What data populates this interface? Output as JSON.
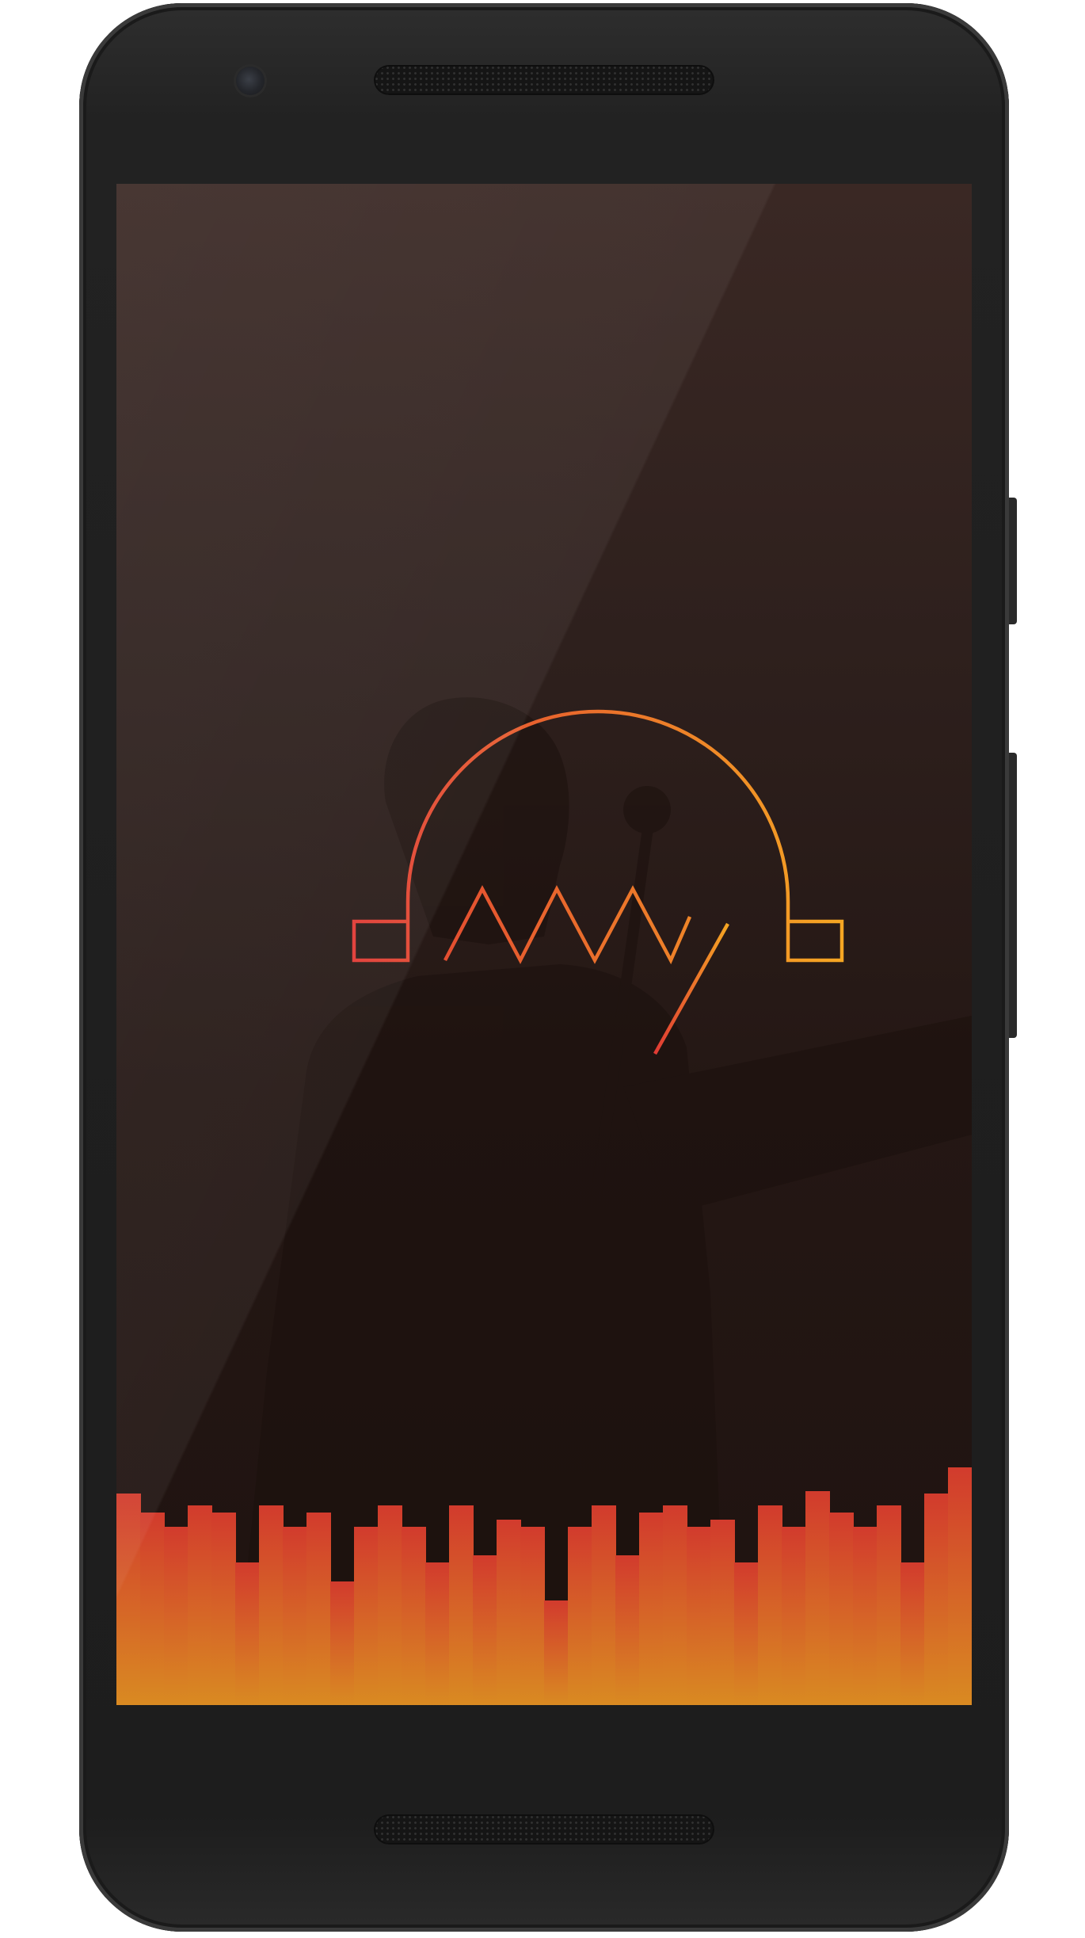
{
  "colors": {
    "background_top": "#3a2824",
    "background_bottom": "#1f1310",
    "logo_gradient_start": "#e03a34",
    "logo_gradient_end": "#f5a623",
    "bar_top": "#d23b2d",
    "bar_bottom": "#d98a22"
  },
  "logo": {
    "name": "headphones-waveform-logo",
    "wordmark_glyphs": "AAAy"
  },
  "equalizer": {
    "levels": [
      0.89,
      0.81,
      0.75,
      0.84,
      0.81,
      0.6,
      0.84,
      0.75,
      0.81,
      0.52,
      0.75,
      0.84,
      0.75,
      0.6,
      0.84,
      0.63,
      0.78,
      0.75,
      0.44,
      0.75,
      0.84,
      0.63,
      0.81,
      0.84,
      0.75,
      0.78,
      0.6,
      0.84,
      0.75,
      0.9,
      0.81,
      0.75,
      0.84,
      0.6,
      0.89,
      1.0
    ]
  }
}
